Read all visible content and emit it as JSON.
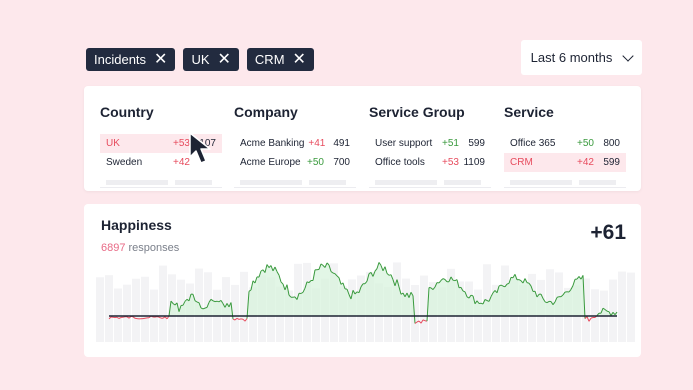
{
  "filters_chips": [
    {
      "label": "Incidents"
    },
    {
      "label": "UK"
    },
    {
      "label": "CRM"
    }
  ],
  "period": {
    "label": "Last 6 months"
  },
  "columns": [
    {
      "title": "Country",
      "rows": [
        {
          "name": "UK",
          "change": "+53",
          "count": "1107",
          "selected": true
        },
        {
          "name": "Sweden",
          "change": "+42",
          "count": "",
          "selected": false
        }
      ]
    },
    {
      "title": "Company",
      "rows": [
        {
          "name": "Acme Banking",
          "change": "+41",
          "count": "491",
          "selected": false
        },
        {
          "name": "Acme Europe",
          "change": "+50",
          "count": "700",
          "selected": false
        }
      ]
    },
    {
      "title": "Service Group",
      "rows": [
        {
          "name": "User support",
          "change": "+51",
          "count": "599",
          "selected": false
        },
        {
          "name": "Office tools",
          "change": "+53",
          "count": "1109",
          "selected": false
        }
      ]
    },
    {
      "title": "Service",
      "rows": [
        {
          "name": "Office 365",
          "change": "+50",
          "count": "800",
          "selected": false
        },
        {
          "name": "CRM",
          "change": "+42",
          "count": "599",
          "selected": true
        }
      ]
    }
  ],
  "happiness": {
    "title": "Happiness",
    "responses_count": "6897",
    "responses_label": "responses",
    "score": "+61"
  },
  "colors": {
    "positive": "#3a9a3e",
    "negative": "#e74c5e",
    "chip_bg": "#222b3f",
    "page_bg": "#fde8ec"
  }
}
